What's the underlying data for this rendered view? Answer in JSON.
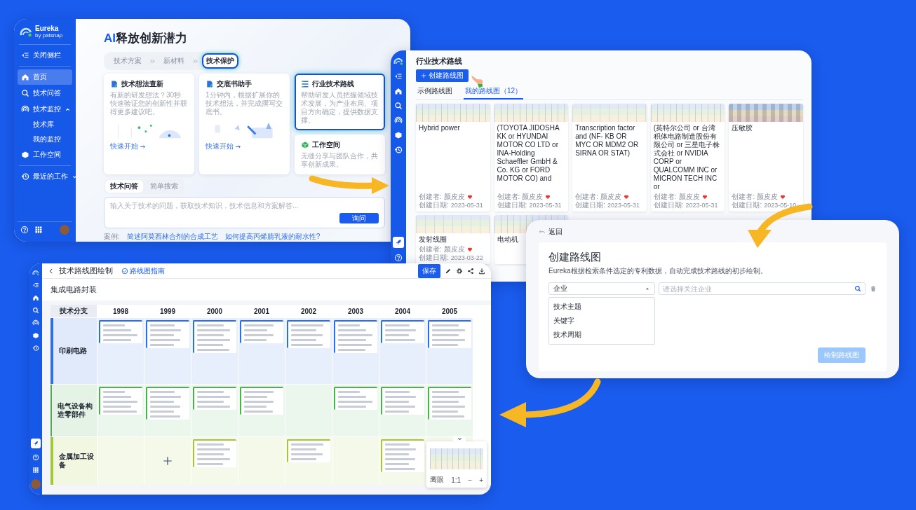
{
  "home_window": {
    "sidebar": {
      "brand": "Eureka",
      "brand_sub": "by patsnap",
      "toggle": "关闭侧栏",
      "items": [
        {
          "label": "首页",
          "selected": true
        },
        {
          "label": "技术问答",
          "selected": false
        },
        {
          "label": "技术监控",
          "selected": false,
          "expanded": true,
          "children": [
            {
              "label": "技术库",
              "selected": false
            },
            {
              "label": "我的监控",
              "selected": false
            }
          ]
        },
        {
          "label": "工作空间",
          "selected": false
        },
        {
          "label": "最近的工作",
          "selected": false,
          "expanded": false
        }
      ]
    },
    "headline_accent": "AI",
    "headline": "释放创新潜力",
    "steps": [
      {
        "label": "技术方案",
        "selected": false
      },
      {
        "label": "新材料",
        "selected": false
      },
      {
        "label": "技术保护",
        "selected": true
      }
    ],
    "cards": [
      {
        "kind": "large",
        "title": "技术想法查新",
        "description": "有新的研发想法？30秒快速验证您的创新性并获得更多建议吧。",
        "link": "快速开始",
        "selected": false
      },
      {
        "kind": "large",
        "title": "交底书助手",
        "description": "1分钟内，根据扩展你的技术想法，并完成撰写交底书。",
        "link": "快速开始",
        "selected": false
      },
      {
        "kind": "small",
        "title": "行业技术路线",
        "description": "帮助研发人员把握领域技术发展，为产业布局、项目方向确定，提供数据支撑。",
        "selected": true
      },
      {
        "kind": "small",
        "title": "工作空间",
        "description": "无缝分享与团队合作，共享创新成果。",
        "selected": false
      }
    ],
    "tabs": [
      {
        "label": "技术问答",
        "selected": true
      },
      {
        "label": "简单搜索",
        "selected": false
      }
    ],
    "question": {
      "placeholder": "输入关于技术的问题，获取技术知识，技术信息和方案解答..."
    },
    "ask_button": "询问",
    "examples_label": "案例:",
    "examples": [
      "简述阿莫西林合剂的合成工艺",
      "如何提高丙烯腈乳液的耐水性?"
    ]
  },
  "roadmaps_window": {
    "title": "行业技术路线",
    "create_button": "创建路线图",
    "tabs": [
      {
        "label": "示例路线图",
        "selected": false
      },
      {
        "label": "我的路线图（12）",
        "selected": true
      }
    ],
    "cards": [
      {
        "title": "Hybrid power",
        "creator_label": "创建者:",
        "creator": "颜皮皮",
        "date_label": "创建日期:",
        "date": "2023-05-31"
      },
      {
        "title": "(TOYOTA JIDOSHA KK or HYUNDAI MOTOR CO LTD or INA-Holding Schaeffler GmbH & Co. KG or FORD MOTOR CO) and",
        "creator_label": "创建者:",
        "creator": "颜皮皮",
        "date_label": "创建日期:",
        "date": "2023-05-31"
      },
      {
        "title": "Transcription factor and (NF- KB OR MYC OR MDM2 OR SIRNA OR STAT)",
        "creator_label": "创建者:",
        "creator": "颜皮皮",
        "date_label": "创建日期:",
        "date": "2023-05-31"
      },
      {
        "title": "(英特尔公司 or 台湾积体电路制造股份有限公司 or 三星电子株式会社 or NVIDIA CORP or QUALCOMM INC or MICRON TECH INC or",
        "creator_label": "创建者:",
        "creator": "颜皮皮",
        "date_label": "创建日期:",
        "date": "2023-05-31"
      },
      {
        "title": "压敏胶",
        "creator_label": "创建者:",
        "creator": "颜皮皮",
        "date_label": "创建日期:",
        "date": "2023-05-10"
      },
      {
        "title": "发射线圈",
        "creator_label": "创建者:",
        "creator": "颜皮皮",
        "date_label": "创建日期:",
        "date": "2023-03-22"
      },
      {
        "title": "电动机"
      }
    ]
  },
  "create_dialog": {
    "back": "返回",
    "title": "创建路线图",
    "description": "Eureka根据检索条件选定的专利数据，自动完成技术路线的初步绘制。",
    "dimension": {
      "value": "企业",
      "expanded": true,
      "options": [
        "技术主题",
        "关键字",
        "技术周期"
      ]
    },
    "search": {
      "placeholder": "请选择关注企业"
    },
    "draw_button": {
      "label": "绘制路线图",
      "disabled": true
    }
  },
  "editor_window": {
    "title": "技术路线图绘制",
    "guide_link": "路线图指南",
    "save_button": "保存",
    "roadmap_title": "集成电路封装",
    "corner": "技术分支",
    "years": [
      "1998",
      "1999",
      "2000",
      "2001",
      "2002",
      "2003",
      "2004",
      "2005"
    ],
    "branches": [
      {
        "label": "印刷电路",
        "color": "#2f6fe0",
        "cells": [
          {
            "kind": "items"
          },
          {
            "kind": "items"
          },
          {
            "kind": "items"
          },
          {
            "kind": "items"
          },
          {
            "kind": "items"
          },
          {
            "kind": "items"
          },
          {
            "kind": "items"
          },
          {
            "kind": "items"
          }
        ]
      },
      {
        "label": "电气设备构造零部件",
        "color": "#4caf50",
        "cells": [
          {
            "kind": "items"
          },
          {
            "kind": "items"
          },
          {
            "kind": "items"
          },
          {
            "kind": "items"
          },
          {
            "kind": "empty"
          },
          {
            "kind": "items"
          },
          {
            "kind": "items"
          },
          {
            "kind": "items"
          }
        ]
      },
      {
        "label": "金属加工设备",
        "color": "#a4c639",
        "cells": [
          {
            "kind": "empty"
          },
          {
            "kind": "add"
          },
          {
            "kind": "items"
          },
          {
            "kind": "empty"
          },
          {
            "kind": "items"
          },
          {
            "kind": "empty"
          },
          {
            "kind": "items"
          },
          {
            "kind": "empty"
          }
        ]
      }
    ],
    "minimap": {
      "label": "鹰眼",
      "zoom": "1:1",
      "zoom_out": "−",
      "zoom_in": "+"
    }
  }
}
